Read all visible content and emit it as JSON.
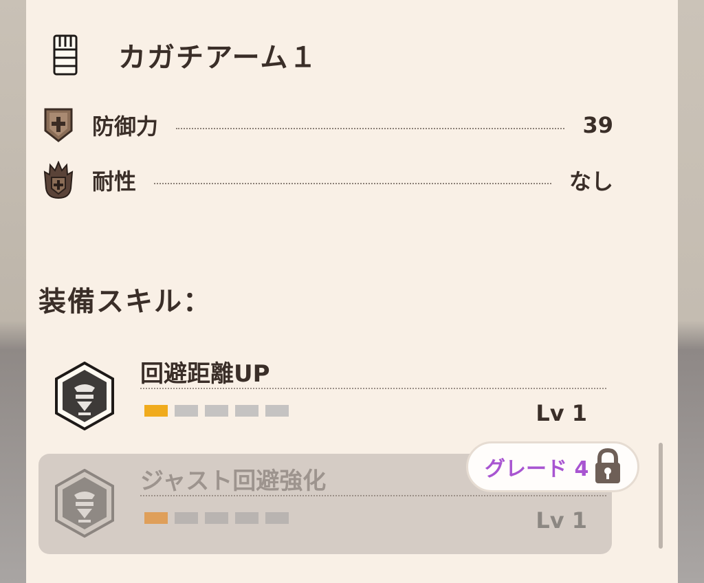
{
  "item": {
    "title": "カガチアーム１",
    "icon": "gauntlet-icon"
  },
  "stats": [
    {
      "label": "防御力",
      "value": "39",
      "icon": "defense-shield-icon"
    },
    {
      "label": "耐性",
      "value": "なし",
      "icon": "resistance-flame-icon"
    }
  ],
  "skills_heading": "装備スキル：",
  "skills": [
    {
      "name": "回避距離UP",
      "level_label": "Lv 1",
      "level": 1,
      "max_level": 5,
      "locked": false,
      "icon": "skill-hexagon-icon"
    },
    {
      "name": "ジャスト回避強化",
      "level_label": "Lv 1",
      "level": 1,
      "max_level": 5,
      "locked": true,
      "icon": "skill-hexagon-icon"
    }
  ],
  "grade_badge": {
    "text": "グレード 4",
    "icon": "padlock-icon"
  },
  "colors": {
    "panel": "#f9f0e6",
    "text": "#3a2e28",
    "pip_on": "#f0ab1d",
    "pip_off": "#c5c3c2",
    "grade": "#a855d1"
  }
}
